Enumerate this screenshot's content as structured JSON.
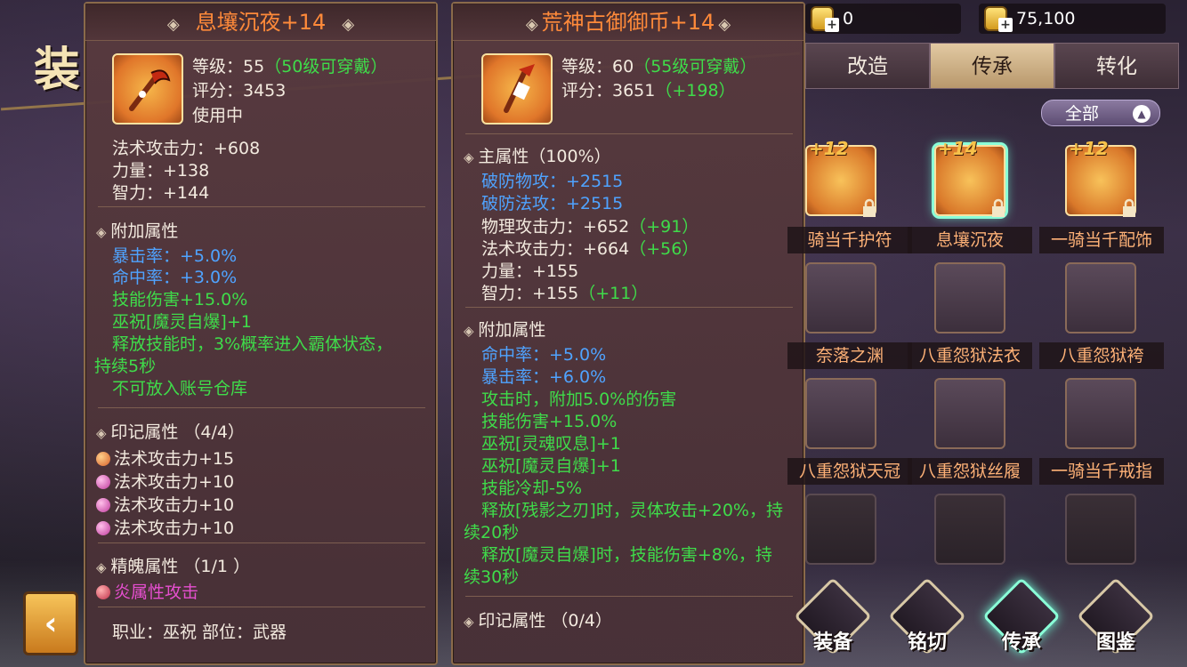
{
  "background": {
    "title_char": "装"
  },
  "currency": [
    {
      "value": "0"
    },
    {
      "value": "75,100"
    }
  ],
  "tabs": [
    {
      "label": "改造",
      "active": false
    },
    {
      "label": "传承",
      "active": true
    },
    {
      "label": "转化",
      "active": false
    }
  ],
  "filter": {
    "label": "全部"
  },
  "grid": [
    {
      "level": "+12",
      "name": "骑当千护符",
      "kind": "orange",
      "locked": true
    },
    {
      "level": "+14",
      "name": "息壤沉夜",
      "kind": "orange",
      "locked": true,
      "selected": true
    },
    {
      "level": "+12",
      "name": "一骑当千配饰",
      "kind": "orange",
      "locked": true
    },
    {
      "level": "",
      "name": "奈落之渊",
      "kind": "plain"
    },
    {
      "level": "",
      "name": "八重怨狱法衣",
      "kind": "plain"
    },
    {
      "level": "",
      "name": "八重怨狱袴",
      "kind": "plain"
    },
    {
      "level": "",
      "name": "八重怨狱天冠",
      "kind": "plain"
    },
    {
      "level": "",
      "name": "八重怨狱丝履",
      "kind": "plain"
    },
    {
      "level": "",
      "name": "一骑当千戒指",
      "kind": "plain"
    }
  ],
  "nav": [
    {
      "label": "装备"
    },
    {
      "label": "铭切"
    },
    {
      "label": "传承",
      "active": true
    },
    {
      "label": "图鉴"
    }
  ],
  "left_panel": {
    "title": "息壤沉夜+14",
    "level_label": "等级：55",
    "level_req": "（50级可穿戴）",
    "score": "评分：3453",
    "status": "使用中",
    "base_stats": [
      "法术攻击力：+608",
      "力量：+138",
      "智力：+144"
    ],
    "extra_header": "附加属性",
    "extra_blue": [
      "暴击率：+5.0%",
      "命中率：+3.0%"
    ],
    "extra_green": [
      "技能伤害+15.0%",
      "巫祝[魔灵自爆]+1",
      "释放技能时，3%概率进入霸体状态，",
      "持续5秒",
      "不可放入账号仓库"
    ],
    "mark_header": "印记属性 （4/4）",
    "marks": [
      "法术攻击力+15",
      "法术攻击力+10",
      "法术攻击力+10",
      "法术攻击力+10"
    ],
    "spirit_header": "精魄属性 （1/1 ）",
    "spirit": "炎属性攻击",
    "footer": "职业：巫祝   部位：武器"
  },
  "right_panel": {
    "title": "荒神古御御币+14",
    "level_label": "等级：60",
    "level_req": "（55级可穿戴）",
    "score": "评分：3651",
    "score_diff": "（+198）",
    "main_header": "主属性（100%）",
    "main_blue": [
      "破防物攻：+2515",
      "破防法攻：+2515"
    ],
    "main_stats": [
      {
        "text": "物理攻击力：+652",
        "diff": "（+91）"
      },
      {
        "text": "法术攻击力：+664",
        "diff": "（+56）"
      },
      {
        "text": "力量：+155",
        "diff": ""
      },
      {
        "text": "智力：+155",
        "diff": "（+11）"
      }
    ],
    "extra_header": "附加属性",
    "extra_blue": [
      "命中率：+5.0%",
      "暴击率：+6.0%"
    ],
    "extra_green": [
      "攻击时，附加5.0%的伤害",
      "技能伤害+15.0%",
      "巫祝[灵魂叹息]+1",
      "巫祝[魔灵自爆]+1",
      "技能冷却-5%",
      "释放[残影之刃]时，灵体攻击+20%，持",
      "续20秒",
      "释放[魔灵自爆]时，技能伤害+8%，持",
      "续30秒"
    ],
    "mark_header": "印记属性 （0/4）"
  }
}
